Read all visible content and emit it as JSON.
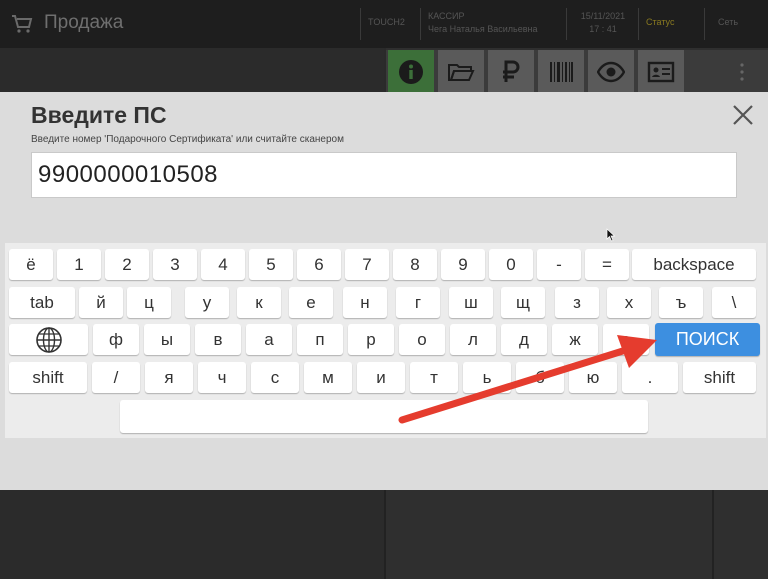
{
  "topbar": {
    "title": "Продажа",
    "terminal": "TOUCH2",
    "cashier_label": "КАССИР",
    "cashier_name": "Чега Наталья Васильевна",
    "date": "15/11/2021",
    "time": "17 : 41",
    "status": "Статус",
    "exit": "Сеть"
  },
  "modal": {
    "title": "Введите ПС",
    "subtitle": "Введите номер 'Подарочного Сертификата' или считайте сканером",
    "input_value": "9900000010508"
  },
  "keyboard": {
    "row1": [
      "ё",
      "1",
      "2",
      "3",
      "4",
      "5",
      "6",
      "7",
      "8",
      "9",
      "0",
      "-",
      "=",
      "backspace"
    ],
    "row2": [
      "tab",
      "й",
      "ц",
      "у",
      "к",
      "е",
      "н",
      "г",
      "ш",
      "щ",
      "з",
      "х",
      "ъ",
      "\\"
    ],
    "row3": [
      "ф",
      "ы",
      "в",
      "а",
      "п",
      "р",
      "о",
      "л",
      "д",
      "ж",
      "э",
      "ПОИСК"
    ],
    "row4": [
      "shift",
      "/",
      "я",
      "ч",
      "с",
      "м",
      "и",
      "т",
      "ь",
      "б",
      "ю",
      ".",
      "shift"
    ]
  },
  "colors": {
    "search_key": "#3d8fe0",
    "active_tool": "#3c6f39",
    "arrow": "#e53c2e"
  },
  "icons": [
    "cart-icon",
    "info-icon",
    "folder-icon",
    "ruble-icon",
    "barcode-icon",
    "eye-icon",
    "id-card-icon",
    "more-icon",
    "close-icon",
    "globe-icon"
  ]
}
